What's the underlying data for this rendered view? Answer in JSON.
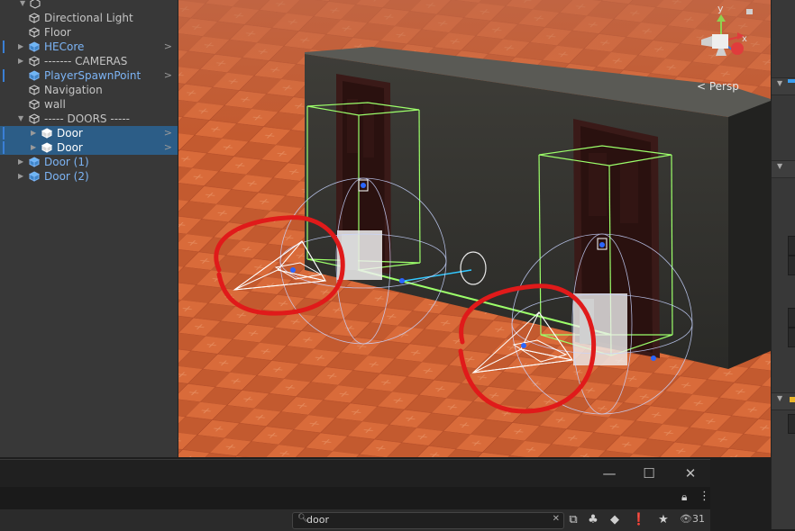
{
  "hierarchy": {
    "items": [
      {
        "label": "Directional Light",
        "type": "object",
        "blue": false,
        "fold": "",
        "chevron": false,
        "selected": false,
        "indent": 1
      },
      {
        "label": "Floor",
        "type": "object",
        "blue": false,
        "fold": "",
        "chevron": false,
        "selected": false,
        "indent": 1
      },
      {
        "label": "HECore",
        "type": "prefab",
        "blue": true,
        "fold": "▶",
        "chevron": true,
        "selected": false,
        "indent": 1,
        "marker": true
      },
      {
        "label": "------- CAMERAS",
        "type": "object",
        "blue": false,
        "fold": "▶",
        "chevron": false,
        "selected": false,
        "indent": 1
      },
      {
        "label": "PlayerSpawnPoint",
        "type": "prefab",
        "blue": true,
        "fold": "",
        "chevron": true,
        "selected": false,
        "indent": 1,
        "marker": true
      },
      {
        "label": "Navigation",
        "type": "object",
        "blue": false,
        "fold": "",
        "chevron": false,
        "selected": false,
        "indent": 1
      },
      {
        "label": "wall",
        "type": "object",
        "blue": false,
        "fold": "",
        "chevron": false,
        "selected": false,
        "indent": 1
      },
      {
        "label": "----- DOORS -----",
        "type": "object",
        "blue": false,
        "fold": "▼",
        "chevron": false,
        "selected": false,
        "indent": 1
      },
      {
        "label": "Door",
        "type": "prefab-white",
        "blue": false,
        "fold": "▶",
        "chevron": true,
        "selected": true,
        "indent": 2,
        "marker": true
      },
      {
        "label": "Door",
        "type": "prefab-white",
        "blue": false,
        "fold": "▶",
        "chevron": true,
        "selected": true,
        "indent": 2,
        "marker": true
      },
      {
        "label": "Door (1)",
        "type": "prefab",
        "blue": true,
        "fold": "▶",
        "chevron": false,
        "selected": false,
        "indent": 1
      },
      {
        "label": "Door (2)",
        "type": "prefab",
        "blue": true,
        "fold": "▶",
        "chevron": false,
        "selected": false,
        "indent": 1
      }
    ]
  },
  "scene": {
    "persp_label": "< Persp",
    "gizmo_y": "y",
    "gizmo_x": "x"
  },
  "bottom_window": {
    "search_value": "door",
    "search_icon": "magnifier-icon",
    "count_value": "31"
  },
  "colors": {
    "selection": "#2c5d87",
    "prefab_blue": "#7cb4f5",
    "annotation_red": "#e01a1a",
    "bounds_green": "#9cff6a"
  }
}
